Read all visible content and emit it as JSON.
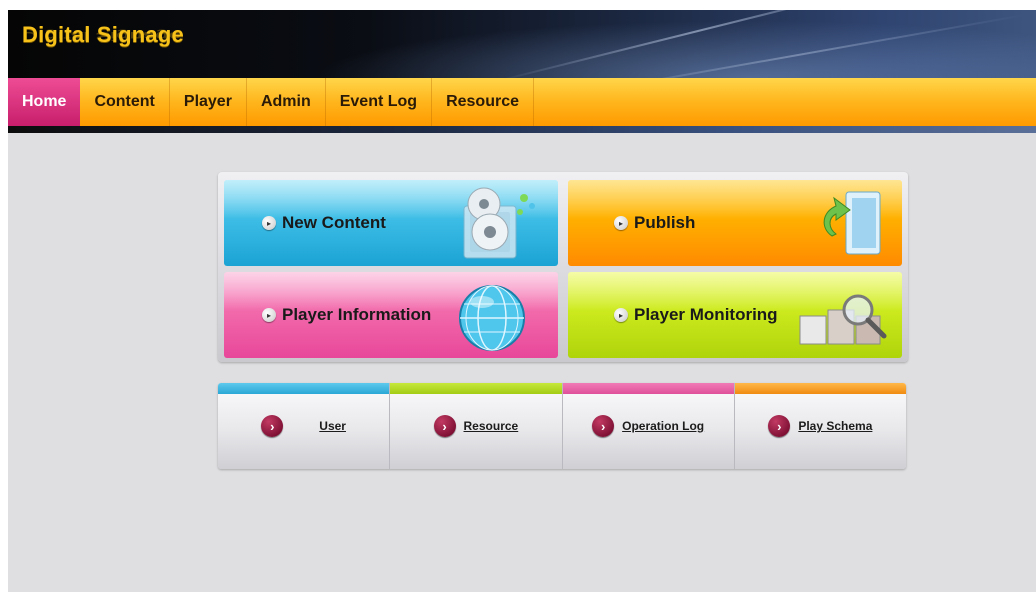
{
  "header": {
    "logo_text": "Digital Signage"
  },
  "nav": {
    "items": [
      {
        "label": "Home",
        "active": true
      },
      {
        "label": "Content",
        "active": false
      },
      {
        "label": "Player",
        "active": false
      },
      {
        "label": "Admin",
        "active": false
      },
      {
        "label": "Event Log",
        "active": false
      },
      {
        "label": "Resource",
        "active": false
      }
    ]
  },
  "tiles": [
    {
      "label": "New Content",
      "color": "#2aaedc",
      "icon": "cd-package-icon"
    },
    {
      "label": "Publish",
      "color": "#ffa500",
      "icon": "publish-arrow-icon"
    },
    {
      "label": "Player Information",
      "color": "#ee5fa5",
      "icon": "globe-icon"
    },
    {
      "label": "Player Monitoring",
      "color": "#c4e41a",
      "icon": "magnifier-monitor-icon"
    }
  ],
  "links": [
    {
      "label": "User",
      "accent": "#2aa7d6"
    },
    {
      "label": "Resource",
      "accent": "#a3cc14"
    },
    {
      "label": "Operation Log",
      "accent": "#e0509a"
    },
    {
      "label": "Play Schema",
      "accent": "#f08b10"
    }
  ],
  "colors": {
    "active_tab": "#d62c7b",
    "nav_bg": "#ffb51c",
    "logo": "#f7c21a"
  }
}
